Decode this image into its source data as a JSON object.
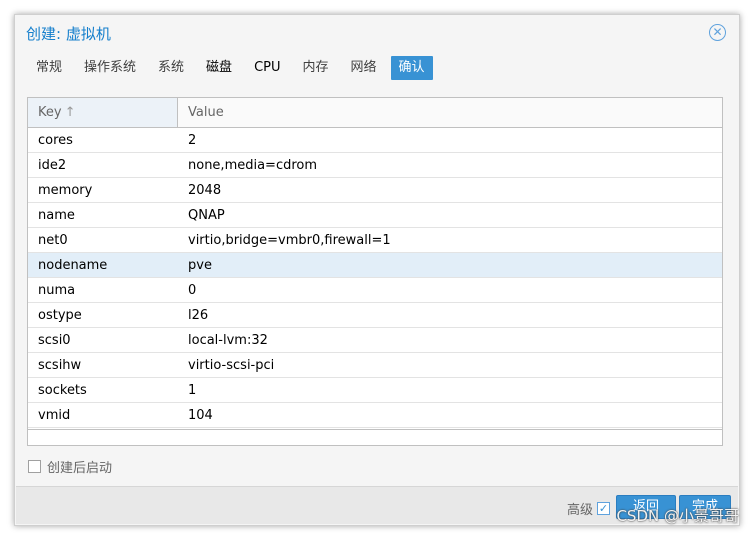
{
  "window": {
    "title": "创建: 虚拟机"
  },
  "tabs": [
    {
      "label": "常规"
    },
    {
      "label": "操作系统"
    },
    {
      "label": "系统"
    },
    {
      "label": "磁盘"
    },
    {
      "label": "CPU"
    },
    {
      "label": "内存"
    },
    {
      "label": "网络"
    },
    {
      "label": "确认"
    }
  ],
  "grid": {
    "columns": {
      "key": "Key",
      "value": "Value"
    },
    "rows": [
      {
        "key": "cores",
        "value": "2"
      },
      {
        "key": "ide2",
        "value": "none,media=cdrom"
      },
      {
        "key": "memory",
        "value": "2048"
      },
      {
        "key": "name",
        "value": "QNAP"
      },
      {
        "key": "net0",
        "value": "virtio,bridge=vmbr0,firewall=1"
      },
      {
        "key": "nodename",
        "value": "pve"
      },
      {
        "key": "numa",
        "value": "0"
      },
      {
        "key": "ostype",
        "value": "l26"
      },
      {
        "key": "scsi0",
        "value": "local-lvm:32"
      },
      {
        "key": "scsihw",
        "value": "virtio-scsi-pci"
      },
      {
        "key": "sockets",
        "value": "1"
      },
      {
        "key": "vmid",
        "value": "104"
      }
    ],
    "selected_row": "nodename"
  },
  "options": {
    "start_after_create": "创建后启动",
    "start_after_create_checked": false
  },
  "footer": {
    "advanced_label": "高级",
    "advanced_checked": true,
    "back_label": "返回",
    "finish_label": "完成"
  },
  "watermark": "CSDN @小景哥哥",
  "colors": {
    "accent": "#3892d4",
    "title": "#157fcc",
    "selected_row": "#e2eef8"
  },
  "icons": {
    "close": "close-circle-icon",
    "sort": "sort-ascending-icon",
    "check": "checkmark-icon"
  }
}
